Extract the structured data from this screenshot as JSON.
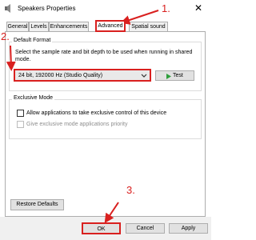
{
  "window": {
    "title": "Speakers Properties",
    "close_glyph": "✕"
  },
  "tabs": [
    {
      "label": "General"
    },
    {
      "label": "Levels"
    },
    {
      "label": "Enhancements"
    },
    {
      "label": "Advanced",
      "selected": true
    },
    {
      "label": "Spatial sound"
    }
  ],
  "default_format": {
    "group_title": "Default Format",
    "description": "Select the sample rate and bit depth to be used when running in shared mode.",
    "selected_value": "24 bit, 192000 Hz (Studio Quality)",
    "test_label": "Test"
  },
  "exclusive_mode": {
    "group_title": "Exclusive Mode",
    "allow_label": "Allow applications to take exclusive control of this device",
    "priority_label": "Give exclusive mode applications priority",
    "allow_checked": false,
    "priority_checked": false
  },
  "restore_defaults_label": "Restore Defaults",
  "footer": {
    "ok_label": "OK",
    "cancel_label": "Cancel",
    "apply_label": "Apply"
  },
  "annotations": {
    "step1": "1.",
    "step2": "2.",
    "step3": "3."
  },
  "colors": {
    "annotation_red": "#d9201f",
    "test_icon_green": "#2e9e3c"
  }
}
